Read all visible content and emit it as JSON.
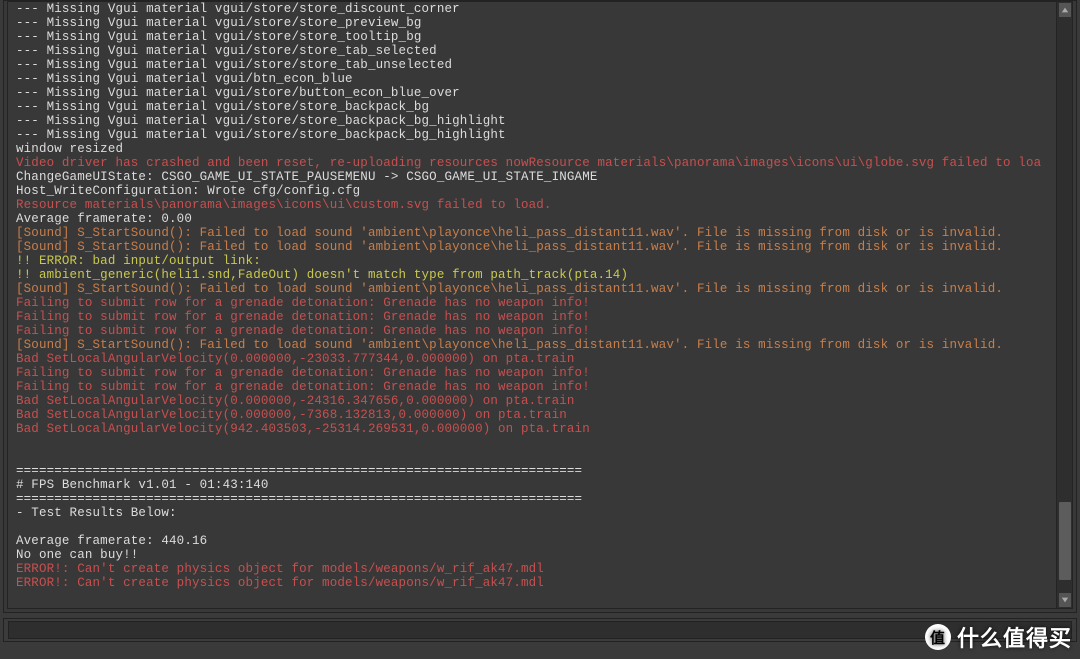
{
  "log": [
    {
      "cls": "c-white",
      "text": "--- Missing Vgui material vgui/store/store_discount_corner"
    },
    {
      "cls": "c-white",
      "text": "--- Missing Vgui material vgui/store/store_preview_bg"
    },
    {
      "cls": "c-white",
      "text": "--- Missing Vgui material vgui/store/store_tooltip_bg"
    },
    {
      "cls": "c-white",
      "text": "--- Missing Vgui material vgui/store/store_tab_selected"
    },
    {
      "cls": "c-white",
      "text": "--- Missing Vgui material vgui/store/store_tab_unselected"
    },
    {
      "cls": "c-white",
      "text": "--- Missing Vgui material vgui/btn_econ_blue"
    },
    {
      "cls": "c-white",
      "text": "--- Missing Vgui material vgui/store/button_econ_blue_over"
    },
    {
      "cls": "c-white",
      "text": "--- Missing Vgui material vgui/store/store_backpack_bg"
    },
    {
      "cls": "c-white",
      "text": "--- Missing Vgui material vgui/store/store_backpack_bg_highlight"
    },
    {
      "cls": "c-white",
      "text": "--- Missing Vgui material vgui/store/store_backpack_bg_highlight"
    },
    {
      "cls": "c-white",
      "text": "window resized"
    },
    {
      "cls": "c-red",
      "text": "Video driver has crashed and been reset, re-uploading resources nowResource materials\\panorama\\images\\icons\\ui\\globe.svg failed to loa"
    },
    {
      "cls": "c-white",
      "text": "ChangeGameUIState: CSGO_GAME_UI_STATE_PAUSEMENU -> CSGO_GAME_UI_STATE_INGAME"
    },
    {
      "cls": "c-white",
      "text": "Host_WriteConfiguration: Wrote cfg/config.cfg"
    },
    {
      "cls": "c-red",
      "text": "Resource materials\\panorama\\images\\icons\\ui\\custom.svg failed to load."
    },
    {
      "cls": "c-white",
      "text": "Average framerate: 0.00"
    },
    {
      "cls": "c-orange",
      "text": "[Sound] S_StartSound(): Failed to load sound 'ambient\\playonce\\heli_pass_distant11.wav'. File is missing from disk or is invalid."
    },
    {
      "cls": "c-orange",
      "text": "[Sound] S_StartSound(): Failed to load sound 'ambient\\playonce\\heli_pass_distant11.wav'. File is missing from disk or is invalid."
    },
    {
      "cls": "c-yellow",
      "text": "!! ERROR: bad input/output link:"
    },
    {
      "cls": "c-yellow",
      "text": "!! ambient_generic(heli1.snd,FadeOut) doesn't match type from path_track(pta.14)"
    },
    {
      "cls": "c-orange",
      "text": "[Sound] S_StartSound(): Failed to load sound 'ambient\\playonce\\heli_pass_distant11.wav'. File is missing from disk or is invalid."
    },
    {
      "cls": "c-red",
      "text": "Failing to submit row for a grenade detonation: Grenade has no weapon info!"
    },
    {
      "cls": "c-red",
      "text": "Failing to submit row for a grenade detonation: Grenade has no weapon info!"
    },
    {
      "cls": "c-red",
      "text": "Failing to submit row for a grenade detonation: Grenade has no weapon info!"
    },
    {
      "cls": "c-orange",
      "text": "[Sound] S_StartSound(): Failed to load sound 'ambient\\playonce\\heli_pass_distant11.wav'. File is missing from disk or is invalid."
    },
    {
      "cls": "c-red",
      "text": "Bad SetLocalAngularVelocity(0.000000,-23033.777344,0.000000) on pta.train"
    },
    {
      "cls": "c-red",
      "text": "Failing to submit row for a grenade detonation: Grenade has no weapon info!"
    },
    {
      "cls": "c-red",
      "text": "Failing to submit row for a grenade detonation: Grenade has no weapon info!"
    },
    {
      "cls": "c-red",
      "text": "Bad SetLocalAngularVelocity(0.000000,-24316.347656,0.000000) on pta.train"
    },
    {
      "cls": "c-red",
      "text": "Bad SetLocalAngularVelocity(0.000000,-7368.132813,0.000000) on pta.train"
    },
    {
      "cls": "c-red",
      "text": "Bad SetLocalAngularVelocity(942.403503,-25314.269531,0.000000) on pta.train"
    },
    {
      "cls": "c-white",
      "text": ""
    },
    {
      "cls": "c-white",
      "text": ""
    },
    {
      "cls": "c-white",
      "text": "=========================================================================="
    },
    {
      "cls": "c-white",
      "text": "# FPS Benchmark v1.01 - 01:43:140"
    },
    {
      "cls": "c-white",
      "text": "=========================================================================="
    },
    {
      "cls": "c-white",
      "text": "- Test Results Below:"
    },
    {
      "cls": "c-white",
      "text": ""
    },
    {
      "cls": "c-white",
      "text": "Average framerate: 440.16"
    },
    {
      "cls": "c-white",
      "text": "No one can buy!!"
    },
    {
      "cls": "c-red",
      "text": "ERROR!: Can't create physics object for models/weapons/w_rif_ak47.mdl"
    },
    {
      "cls": "c-red",
      "text": "ERROR!: Can't create physics object for models/weapons/w_rif_ak47.mdl"
    },
    {
      "cls": "c-white",
      "text": ""
    }
  ],
  "watermark": {
    "logo_char": "值",
    "text": "什么值得买"
  }
}
